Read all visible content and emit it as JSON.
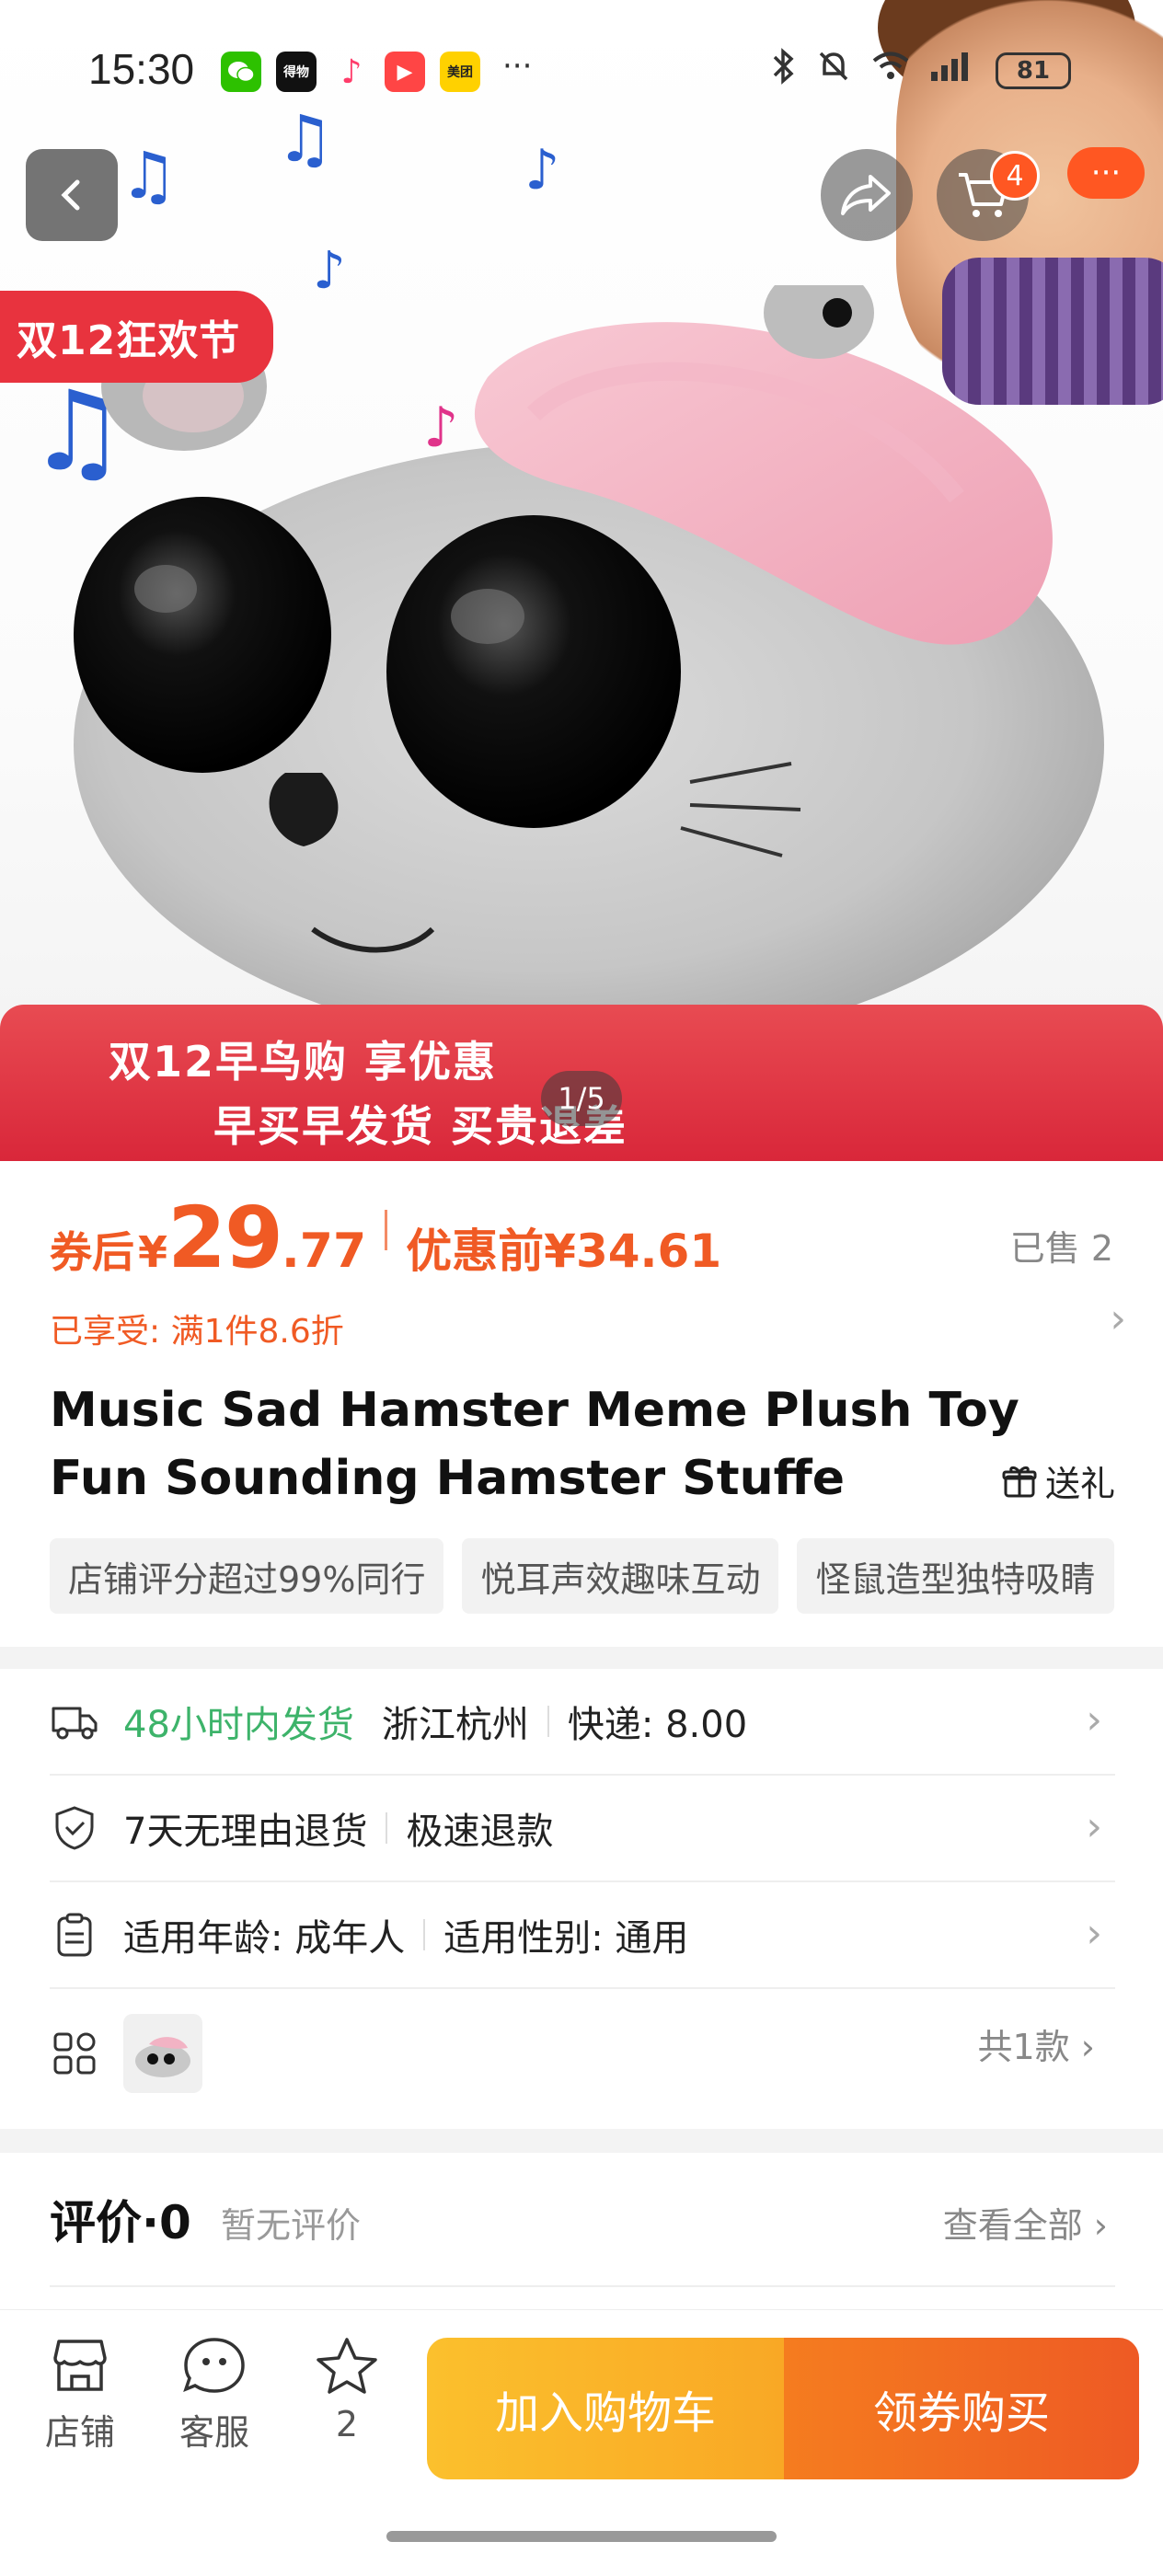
{
  "status_bar": {
    "time": "15:30",
    "apps": [
      {
        "name": "wechat-icon",
        "color": "#2dc100",
        "label": ""
      },
      {
        "name": "dewu-icon",
        "color": "#111111",
        "label": "得物"
      },
      {
        "name": "music-icon",
        "color": "#ff3c6a",
        "label": "♪"
      },
      {
        "name": "video-icon",
        "color": "#ff4545",
        "label": "▶"
      },
      {
        "name": "meituan-icon",
        "color": "#ffd100",
        "label": "美团"
      }
    ],
    "more": "···",
    "battery": "81"
  },
  "header": {
    "cart_badge": "4",
    "more_label": "···"
  },
  "hero": {
    "promo_tag": "双12狂欢节",
    "banner_line1": "双12早鸟购 享优惠",
    "banner_line2": "早买早发货 买贵退差",
    "pager": "1/5"
  },
  "price": {
    "prefix": "券后",
    "currency": "¥",
    "integer": "29",
    "decimal": ".77",
    "before": "优惠前¥34.61",
    "sold": "已售 2",
    "enjoyed": "已享受: 满1件8.6折"
  },
  "product": {
    "title": "Music Sad Hamster Meme Plush Toy Fun Sounding Hamster Stuffe",
    "gift_label": "送礼",
    "tags": [
      "店铺评分超过99%同行",
      "悦耳声效趣味互动",
      "怪鼠造型独特吸睛"
    ]
  },
  "service": {
    "shipping_time": "48小时内发货",
    "origin": "浙江杭州",
    "express": "快递: 8.00",
    "return_policy": "7天无理由退货",
    "refund": "极速退款",
    "age": "适用年龄: 成年人",
    "gender": "适用性别: 通用",
    "variant_count": "共1款"
  },
  "review": {
    "title": "评价·0",
    "none": "暂无评价",
    "view_all": "查看全部"
  },
  "bottom_bar": {
    "store": "店铺",
    "service": "客服",
    "favorites": "2",
    "add_cart": "加入购物车",
    "buy": "领券购买"
  },
  "colors": {
    "accent": "#f05a24",
    "promo_red": "#e8333e",
    "green": "#3db36a",
    "cart_yellow": "#f9a825"
  }
}
